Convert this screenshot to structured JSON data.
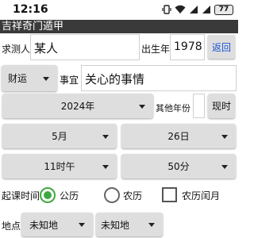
{
  "status_bar": {
    "time": "12:16",
    "battery": "77"
  },
  "app": {
    "title": "吉祥奇门遁甲"
  },
  "form": {
    "seeker_label": "求测人",
    "seeker_value": "某人",
    "birth_year_label": "出生年",
    "birth_year_value": "1978",
    "back_button": "返回",
    "category_value": "财运",
    "matter_label": "事宜",
    "matter_value": "关心的事情",
    "year_value": "2024年",
    "other_year_label": "其他年份",
    "other_year_value": "",
    "now_button": "现时",
    "month_value": "5月",
    "day_value": "26日",
    "hour_value": "11时午",
    "minute_value": "50分",
    "start_time_label": "起课时间",
    "calendar_options": [
      "公历",
      "农历"
    ],
    "calendar_selected": "公历",
    "leap_month_label": "农历闰月",
    "leap_month_checked": false,
    "location_label": "地点",
    "location_primary": "未知地",
    "location_secondary": "未知地"
  },
  "colors": {
    "title_bar": "#3a3a3a",
    "back_button_text": "#1a56d6",
    "radio_selected": "#3ea83e",
    "button_bg": "#dedede"
  }
}
